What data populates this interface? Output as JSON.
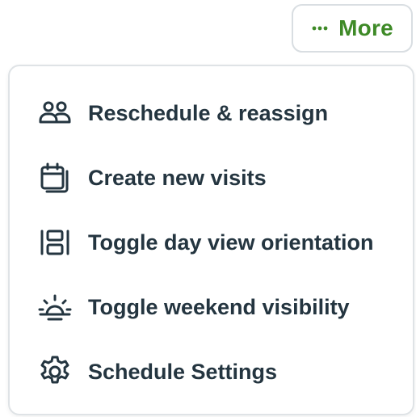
{
  "header": {
    "more_button": {
      "label": "More",
      "icon": "more-dots-icon"
    }
  },
  "menu": {
    "items": [
      {
        "label": "Reschedule & reassign",
        "icon": "users-icon"
      },
      {
        "label": "Create new visits",
        "icon": "calendar-stack-icon"
      },
      {
        "label": "Toggle day view orientation",
        "icon": "layout-columns-icon"
      },
      {
        "label": "Toggle weekend visibility",
        "icon": "sunrise-icon"
      },
      {
        "label": "Schedule Settings",
        "icon": "gear-icon"
      }
    ]
  },
  "colors": {
    "accent": "#3e8a27",
    "text": "#243540",
    "border": "#dfe3e6"
  }
}
